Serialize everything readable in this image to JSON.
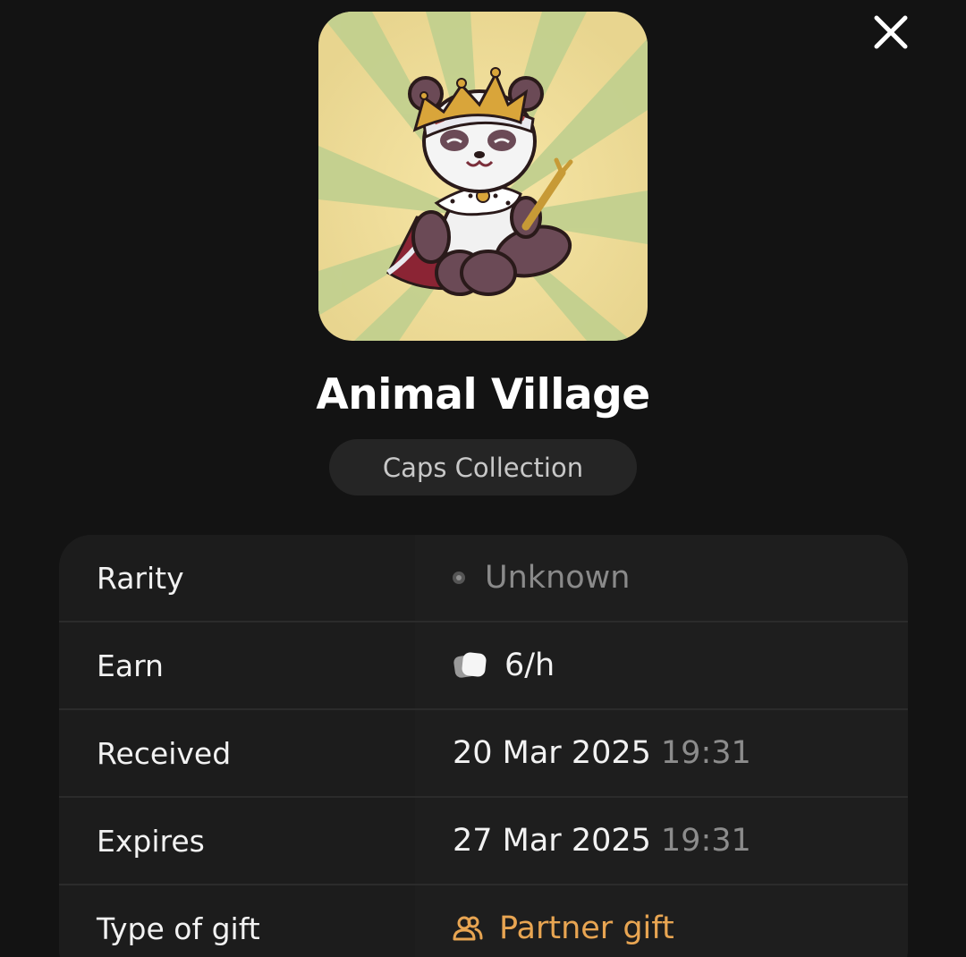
{
  "header": {
    "close_icon": "close-icon"
  },
  "artwork": {
    "subject": "panda-king-icon",
    "background_colors": [
      "#f6dc95",
      "#c3d08f"
    ]
  },
  "gift": {
    "title": "Animal Village",
    "collection": "Caps Collection"
  },
  "details": {
    "rarity": {
      "label": "Rarity",
      "value": "Unknown",
      "icon": "dot-icon"
    },
    "earn": {
      "label": "Earn",
      "value": "6/h",
      "icon": "caps-coin-icon"
    },
    "received": {
      "label": "Received",
      "date": "20 Mar 2025",
      "time": "19:31"
    },
    "expires": {
      "label": "Expires",
      "date": "27 Mar 2025",
      "time": "19:31"
    },
    "type": {
      "label": "Type of gift",
      "value": "Partner gift",
      "icon": "users-icon",
      "color": "#e8a552"
    }
  }
}
